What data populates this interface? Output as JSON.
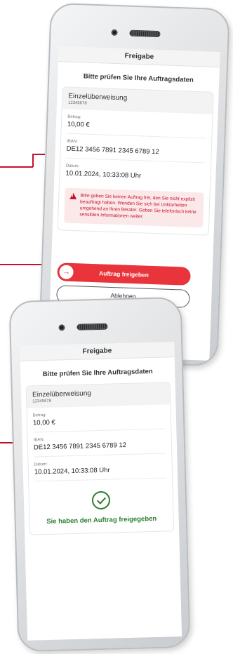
{
  "screen_before": {
    "header_title": "Freigabe",
    "subtitle": "Bitte prüfen Sie Ihre Auftragsdaten",
    "order": {
      "title": "Einzelüberweisung",
      "number": "12345678",
      "amount_label": "Betrag:",
      "amount": "10,00 €",
      "iban_label": "IBAN:",
      "iban": "DE12 3456 7891 2345 6789 12",
      "date_label": "Datum:",
      "date": "10.01.2024, 10:33:08 Uhr"
    },
    "warning": "Bitte geben Sie keinen Auftrag frei, den Sie nicht explizit beauftragt haben. Wenden Sie sich bei Unklarheiten umgehend an Ihren Berater. Geben Sie telefonisch keine sensiblen Informationen weiter.",
    "approve_button": "Auftrag freigeben",
    "arrow_symbol": "→",
    "reject_button": "Ablehnen"
  },
  "screen_after": {
    "header_title": "Freigabe",
    "subtitle": "Bitte prüfen Sie Ihre Auftragsdaten",
    "order": {
      "title": "Einzelüberweisung",
      "number": "12345678",
      "amount_label": "Betrag:",
      "amount": "10,00 €",
      "iban_label": "IBAN:",
      "iban": "DE12 3456 7891 2345 6789 12",
      "date_label": "Datum:",
      "date": "10.01.2024, 10:33:08 Uhr"
    },
    "success_message": "Sie haben den Auftrag freigegeben"
  },
  "colors": {
    "accent_red": "#e8343a",
    "warning_bg": "#fbe9e9",
    "success_green": "#2e7d32"
  }
}
